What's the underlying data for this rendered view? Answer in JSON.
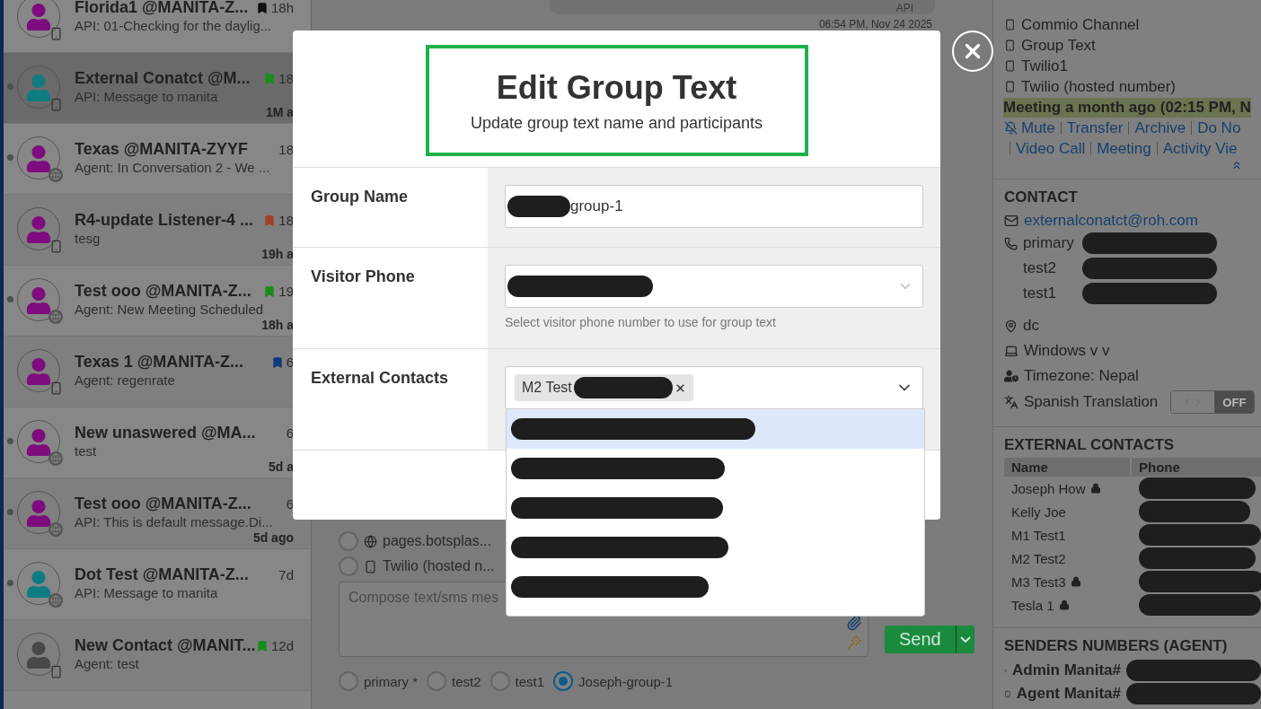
{
  "conversations": [
    {
      "name": "Florida1 @MANITA-Z...",
      "preview": "API: 01-Checking for the daylig...",
      "time": "18h",
      "avatar": {
        "color": "#7e0c7e"
      },
      "kind": "phone",
      "flag": {
        "color": "#111111"
      },
      "unread": false,
      "selected": false
    },
    {
      "name": "External Conatct @M...",
      "preview": "API: Message to manita",
      "time": "18",
      "ago": "1M a",
      "avatar": {
        "color": "#0f7c82"
      },
      "kind": "phone",
      "flag": {
        "color": "#1a8c1a"
      },
      "unread": true,
      "selected": true
    },
    {
      "name": "Texas @MANITA-ZYYF",
      "preview": "Agent: In Conversation 2 - We ...",
      "time": "18",
      "avatar": {
        "color": "#7e0c7e"
      },
      "kind": "web",
      "unread": true,
      "selected": false
    },
    {
      "name": "R4-update Listener-4 ...",
      "preview": "tesg",
      "time": "18",
      "ago": "19h a",
      "avatar": {
        "color": "#7e0c7e"
      },
      "kind": "phone",
      "flag": {
        "color": "#a0402a"
      },
      "unread": false,
      "selected": false
    },
    {
      "name": "Test ooo @MANITA-Z...",
      "preview": "Agent: New Meeting Scheduled",
      "time": "19",
      "ago": "18h a",
      "avatar": {
        "color": "#7e0c7e"
      },
      "kind": "web",
      "flag": {
        "color": "#1a8c1a"
      },
      "unread": true,
      "selected": false
    },
    {
      "name": "Texas 1 @MANITA-Z...",
      "preview": "Agent: regenrate",
      "time": "6",
      "avatar": {
        "color": "#7e0c7e"
      },
      "kind": "phone",
      "flag": {
        "color": "#123a78"
      },
      "unread": false,
      "selected": false
    },
    {
      "name": "New unaswered @MA...",
      "preview": "test",
      "time": "6",
      "ago": "5d a",
      "avatar": {
        "color": "#7e0c7e"
      },
      "kind": "web",
      "unread": true,
      "selected": false
    },
    {
      "name": "Test ooo @MANITA-Z...",
      "preview": "API: This is default message.Di...",
      "time": "6",
      "ago": "5d ago",
      "avatar": {
        "color": "#7e0c7e"
      },
      "kind": "web",
      "unread": true,
      "selected": false
    },
    {
      "name": "Dot Test @MANITA-Z...",
      "preview": "API: Message to manita",
      "time": "7d",
      "avatar": {
        "color": "#0f7c82"
      },
      "kind": "web",
      "unread": true,
      "selected": false
    },
    {
      "name": "New Contact @MANIT...",
      "preview": "Agent: test",
      "time": "12d",
      "avatar": {
        "color": "#484848"
      },
      "kind": "phone",
      "flag": {
        "color": "#1a8c1a"
      },
      "unread": false,
      "selected": false
    }
  ],
  "chat": {
    "bubble_text": "API",
    "timestamp": "06:54 PM, Nov 24 2025",
    "senders": [
      {
        "label": "pages.botsplas...",
        "kind": "web",
        "selected": false
      },
      {
        "label": "Twilio (hosted n...",
        "kind": "phone",
        "selected": false
      }
    ],
    "compose": {
      "placeholder": "Compose text/sms mes"
    },
    "send": "Send",
    "recipients": [
      {
        "label": "primary *",
        "selected": false
      },
      {
        "label": "test2",
        "selected": false
      },
      {
        "label": "test1",
        "selected": false
      },
      {
        "label": "Joseph-group-1",
        "selected": true
      }
    ]
  },
  "details": {
    "channels": [
      {
        "label": "Commio Channel",
        "kind": "phone"
      },
      {
        "label": "Group Text",
        "kind": "phone"
      },
      {
        "label": "Twilio1",
        "kind": "phone"
      },
      {
        "label": "Twilio (hosted number)",
        "kind": "phone"
      }
    ],
    "meeting": "Meeting a month ago (02:15 PM, N",
    "actions": [
      [
        "Mute",
        "Transfer",
        "Archive",
        "Do No"
      ],
      [
        "Video Call",
        "Meeting",
        "Activity Vie"
      ]
    ],
    "contact": {
      "heading": "CONTACT",
      "email": "externalconatct@roh.com",
      "phones": [
        {
          "label": "primary"
        },
        {
          "label": "test2"
        },
        {
          "label": "test1"
        }
      ],
      "location": "dc",
      "device": "Windows v v",
      "timezone": "Timezone: Nepal",
      "translation": {
        "label": "Spanish Translation",
        "state": "OFF",
        "on": false
      }
    },
    "external_contacts": {
      "heading": "EXTERNAL CONTACTS",
      "columns": [
        "Name",
        "Phone"
      ],
      "rows": [
        {
          "name": "Joseph How",
          "locked": true
        },
        {
          "name": "Kelly Joe",
          "locked": false
        },
        {
          "name": "M1 Test1",
          "locked": false
        },
        {
          "name": "M2 Test2",
          "locked": false
        },
        {
          "name": "M3 Test3",
          "locked": true
        },
        {
          "name": "Tesla 1",
          "locked": true
        }
      ]
    },
    "senders": {
      "heading": "SENDERS NUMBERS (AGENT)",
      "items": [
        "Admin Manita#",
        "Agent Manita#"
      ]
    }
  },
  "modal": {
    "title": "Edit Group Text",
    "subtitle": "Update group text name and participants",
    "fields": [
      {
        "label": "Group Name",
        "kind": "text",
        "value": "group-1"
      },
      {
        "label": "Visitor Phone",
        "kind": "select",
        "hint": "Select visitor phone number to use for group text"
      },
      {
        "label": "External Contacts",
        "kind": "multiselect",
        "tags": [
          "M2 Test"
        ]
      }
    ],
    "options": [
      {
        "highlighted": true
      },
      {
        "highlighted": false
      },
      {
        "highlighted": false
      },
      {
        "highlighted": false
      },
      {
        "highlighted": false
      }
    ]
  }
}
